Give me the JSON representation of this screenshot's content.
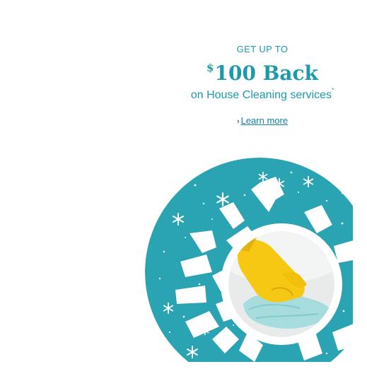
{
  "promo": {
    "eyebrow": "GET UP TO",
    "currency": "$",
    "amount": "100 Back",
    "subline": "on House Cleaning services",
    "asterisk": "*",
    "link_chevron": "›",
    "link_label": "Learn more"
  },
  "colors": {
    "accent": "#1b9aab",
    "link": "#0f80a6",
    "circle": "#2aa3b2",
    "glove": "#f6c814",
    "cloth": "#a7dcdf"
  },
  "icons": [
    "snowflake-icon",
    "glove-icon"
  ]
}
